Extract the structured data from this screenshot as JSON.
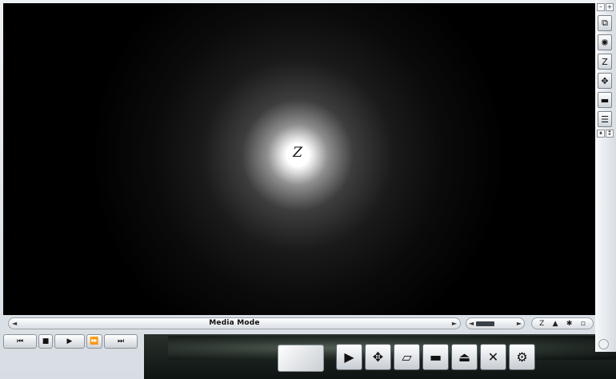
{
  "status": {
    "mode_label": "Media Mode",
    "volume_level": 0.45
  },
  "video": {
    "logo_glyph": "Z"
  },
  "seek": {
    "left_arrow": "◄",
    "right_arrow": "►"
  },
  "volume_arrows": {
    "left": "◄",
    "right": "►"
  },
  "mini_tools": [
    "Z",
    "▲",
    "✱",
    "▫"
  ],
  "sidebar": {
    "top_left": "–",
    "top_right": "+",
    "buttons": [
      {
        "icon": "window-icon",
        "glyph": "⧉"
      },
      {
        "icon": "settings-icon",
        "glyph": "✺"
      },
      {
        "icon": "logo-icon",
        "glyph": "Z"
      },
      {
        "icon": "navigate-icon",
        "glyph": "✥"
      },
      {
        "icon": "bar-icon",
        "glyph": "▬"
      },
      {
        "icon": "list-icon",
        "glyph": "☰"
      }
    ],
    "bottom_left": "⏸",
    "bottom_right": "↕"
  },
  "transport": [
    {
      "name": "previous-button",
      "glyph": "⏮"
    },
    {
      "name": "stop-button",
      "glyph": "■"
    },
    {
      "name": "play-button",
      "glyph": "▶"
    },
    {
      "name": "fast-forward-button",
      "glyph": "⏩"
    },
    {
      "name": "next-button",
      "glyph": "⏭"
    }
  ],
  "big_tools": [
    {
      "name": "play-tool-button",
      "glyph": "▶"
    },
    {
      "name": "navigate-tool-button",
      "glyph": "✥"
    },
    {
      "name": "record-tool-button",
      "glyph": "▱"
    },
    {
      "name": "line-tool-button",
      "glyph": "▬"
    },
    {
      "name": "eject-tool-button",
      "glyph": "⏏"
    },
    {
      "name": "cancel-tool-button",
      "glyph": "✕"
    },
    {
      "name": "settings-tool-button",
      "glyph": "⚙"
    }
  ],
  "colors": {
    "frame": "#e4e8ec",
    "video_background": "#000000"
  }
}
